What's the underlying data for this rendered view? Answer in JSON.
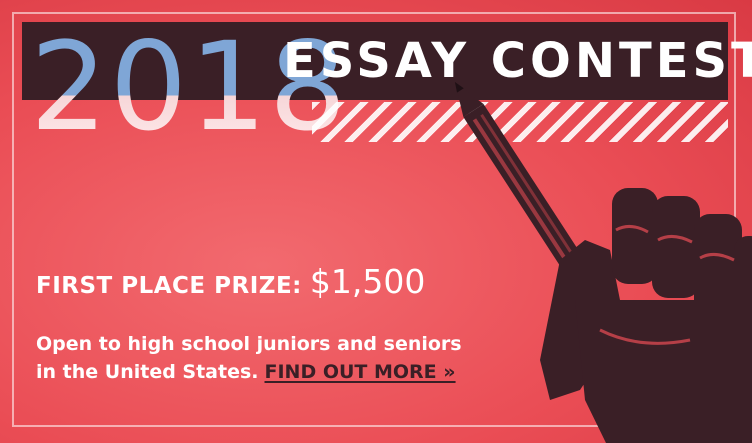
{
  "banner": {
    "year": "2018",
    "headline": "ESSAY CONTEST",
    "prize_label": "FIRST PLACE PRIZE:",
    "prize_amount": "$1,500",
    "description_line1": "Open to high school juniors and seniors",
    "description_line2": "in the United States.",
    "cta_label": "FIND OUT MORE »"
  },
  "colors": {
    "background": "#ea4d55",
    "title_bar": "#3a1f26",
    "year_accent": "#7fa6d6",
    "text": "#ffffff",
    "cta_text": "#3a1f26"
  },
  "icons": {
    "illustration": "fist-holding-pencil-icon"
  }
}
